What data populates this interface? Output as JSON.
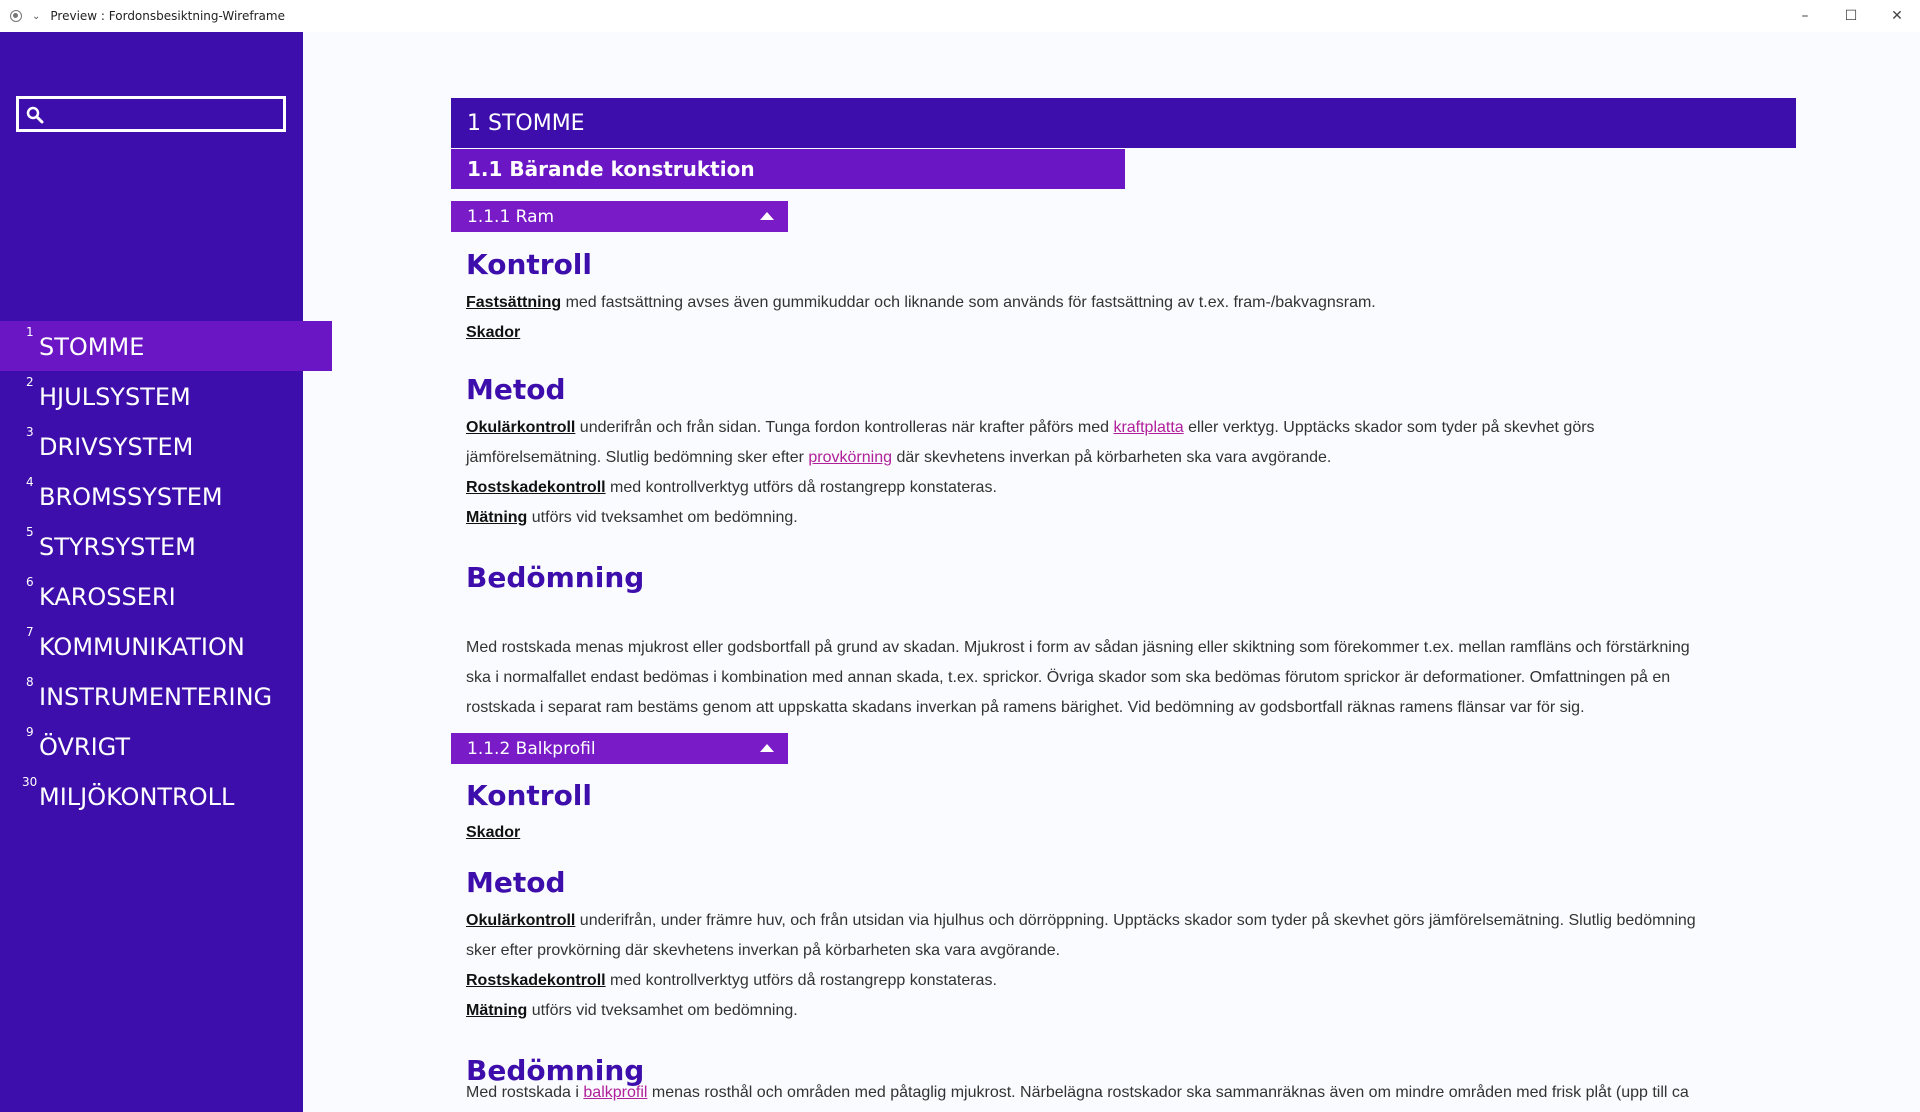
{
  "window": {
    "title": "Preview : Fordonsbesiktning-Wireframe",
    "controls": {
      "minimize": "–",
      "maximize": "☐",
      "close": "✕"
    }
  },
  "sidebar": {
    "search_placeholder": "",
    "items": [
      {
        "num": "1",
        "label": "STOMME"
      },
      {
        "num": "2",
        "label": "HJULSYSTEM"
      },
      {
        "num": "3",
        "label": "DRIVSYSTEM"
      },
      {
        "num": "4",
        "label": "BROMSSYSTEM"
      },
      {
        "num": "5",
        "label": "STYRSYSTEM"
      },
      {
        "num": "6",
        "label": "KAROSSERI"
      },
      {
        "num": "7",
        "label": "KOMMUNIKATION"
      },
      {
        "num": "8",
        "label": "INSTRUMENTERING"
      },
      {
        "num": "9",
        "label": "ÖVRIGT"
      },
      {
        "num": "30",
        "label": "MILJÖKONTROLL"
      }
    ]
  },
  "content": {
    "h1": "1 STOMME",
    "h2": "1.1 Bärande konstruktion",
    "ram": {
      "header": "1.1.1 Ram",
      "kontroll": {
        "title": "Kontroll",
        "p1_term": "Fastsättning",
        "p1_text": " med fastsättning avses även gummikuddar och liknande som används för fastsättning av t.ex. fram-/bakvagnsram.",
        "p2_term": "Skador"
      },
      "metod": {
        "title": "Metod",
        "p1_term": "Okulärkontroll",
        "p1_a": " underifrån och från sidan. Tunga fordon kontrolleras när krafter påförs med ",
        "p1_link1": "kraftplatta",
        "p1_b": " eller verktyg. Upptäcks skador som tyder på skevhet görs",
        "p1_c": "jämförelsemätning. Slutlig bedömning sker efter ",
        "p1_link2": "provkörning",
        "p1_d": " där skevhetens inverkan på körbarheten ska vara avgörande.",
        "p2_term": "Rostskadekontroll",
        "p2_text": " med kontrollverktyg utförs då rostangrepp konstateras.",
        "p3_term": "Mätning",
        "p3_text": " utförs vid tveksamhet om bedömning."
      },
      "bedomning": {
        "title": "Bedömning",
        "l1": "Med rostskada menas mjukrost eller godsbortfall på grund av skadan. Mjukrost i form av sådan jäsning eller skiktning som förekommer t.ex. mellan ramfläns och förstärkning",
        "l2": "ska i normalfallet endast bedömas i kombination med annan skada, t.ex. sprickor. Övriga skador som ska bedömas förutom sprickor är deformationer. Omfattningen på en",
        "l3": "rostskada i separat ram bestäms genom att uppskatta skadans inverkan på ramens bärighet. Vid bedömning av godsbortfall räknas ramens flänsar var för sig."
      }
    },
    "balk": {
      "header": "1.1.2 Balkprofil",
      "kontroll": {
        "title": "Kontroll",
        "p1_term": "Skador"
      },
      "metod": {
        "title": "Metod",
        "p1_term": "Okulärkontroll",
        "p1_a": " underifrån, under främre huv, och från utsidan via hjulhus och dörröppning. Upptäcks skador som tyder på skevhet görs jämförelsemätning. Slutlig bedömning",
        "p1_b": "sker efter provkörning där skevhetens inverkan på körbarheten ska vara avgörande.",
        "p2_term": "Rostskadekontroll",
        "p2_text": " med kontrollverktyg utförs då rostangrepp konstateras.",
        "p3_term": "Mätning",
        "p3_text": " utförs vid tveksamhet om bedömning."
      },
      "bedomning": {
        "title": "Bedömning",
        "l1_a": "Med rostskada i ",
        "l1_link": "balkprofil",
        "l1_b": " menas rosthål och områden med påtaglig mjukrost. Närbelägna rostskador ska sammanräknas även om mindre områden med frisk plåt (upp till ca"
      }
    }
  },
  "colors": {
    "sidebar": "#3d0eab",
    "active": "#6b16c4",
    "heading": "#3d0eab",
    "link": "#b0209a"
  }
}
